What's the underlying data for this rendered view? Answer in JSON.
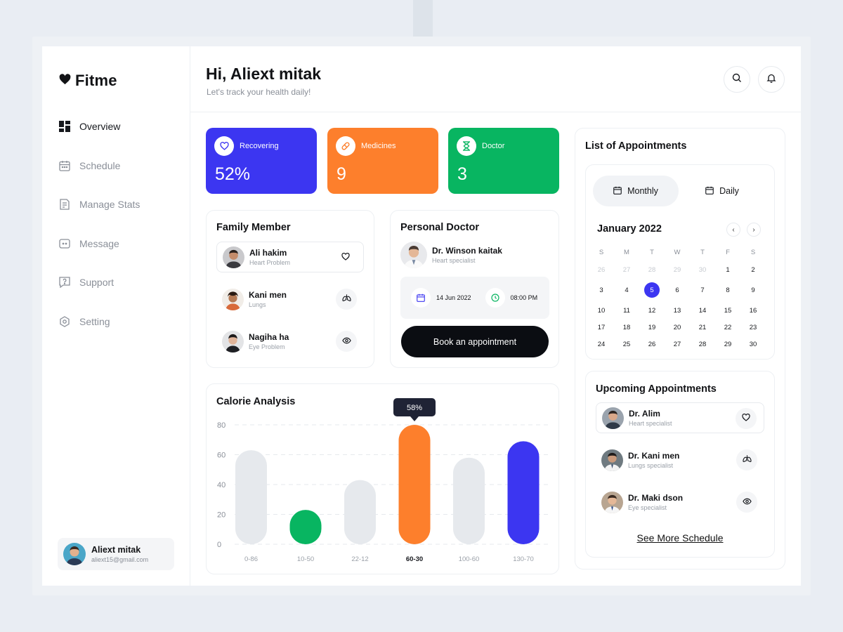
{
  "brand": {
    "name": "Fitme"
  },
  "sidebar": {
    "items": [
      {
        "label": "Overview",
        "active": true,
        "icon": "grid-icon"
      },
      {
        "label": "Schedule",
        "active": false,
        "icon": "calendar-icon"
      },
      {
        "label": "Manage Stats",
        "active": false,
        "icon": "report-icon"
      },
      {
        "label": "Message",
        "active": false,
        "icon": "message-icon"
      },
      {
        "label": "Support",
        "active": false,
        "icon": "support-icon"
      },
      {
        "label": "Setting",
        "active": false,
        "icon": "hexagon-settings-icon"
      }
    ],
    "user": {
      "name": "Aliext mitak",
      "email": "aliext15@gmail.com"
    }
  },
  "header": {
    "title": "Hi, Aliext mitak",
    "subtitle": "Let's track your health daily!"
  },
  "stats": [
    {
      "label": "Recovering",
      "value": "52%",
      "color": "#3c36f1",
      "icon": "heart-icon"
    },
    {
      "label": "Medicines",
      "value": "9",
      "color": "#fd7f2c",
      "icon": "pill-icon"
    },
    {
      "label": "Doctor",
      "value": "3",
      "color": "#08b561",
      "icon": "hourglass-icon"
    }
  ],
  "family": {
    "title": "Family Member",
    "members": [
      {
        "name": "Ali hakim",
        "condition": "Heart Problem",
        "icon": "heart-icon"
      },
      {
        "name": "Kani men",
        "condition": "Lungs",
        "icon": "lungs-icon"
      },
      {
        "name": "Nagiha ha",
        "condition": "Eye Problem",
        "icon": "eye-icon"
      }
    ]
  },
  "doctor": {
    "title": "Personal Doctor",
    "name": "Dr. Winson kaitak",
    "specialty": "Heart specialist",
    "date": "14 Jun 2022",
    "time": "08:00 PM",
    "book_label": "Book an appointment"
  },
  "calorie": {
    "title": "Calorie Analysis",
    "tooltip": "58%"
  },
  "chart_data": {
    "type": "bar",
    "title": "Calorie Analysis",
    "categories": [
      "0-86",
      "10-50",
      "22-12",
      "60-30",
      "100-60",
      "130-70"
    ],
    "values": [
      63,
      23,
      43,
      80,
      58,
      69
    ],
    "colors": [
      "#e6e9ed",
      "#08b561",
      "#e6e9ed",
      "#fd7f2c",
      "#e6e9ed",
      "#3c36f1"
    ],
    "highlight_index": 3,
    "yticks": [
      0,
      20,
      40,
      60,
      80
    ],
    "ylim": [
      0,
      80
    ],
    "grid": true
  },
  "appointments": {
    "title": "List of Appointments",
    "tabs": [
      {
        "label": "Monthly",
        "active": true
      },
      {
        "label": "Daily",
        "active": false
      }
    ],
    "calendar": {
      "month": "January 2022",
      "dow": [
        "S",
        "M",
        "T",
        "W",
        "T",
        "F",
        "S"
      ],
      "weeks": [
        [
          "26",
          "27",
          "28",
          "29",
          "30",
          "1",
          "2"
        ],
        [
          "3",
          "4",
          "5",
          "6",
          "7",
          "8",
          "9"
        ],
        [
          "10",
          "11",
          "12",
          "13",
          "14",
          "15",
          "16"
        ],
        [
          "17",
          "18",
          "19",
          "20",
          "21",
          "22",
          "23"
        ],
        [
          "24",
          "25",
          "26",
          "27",
          "28",
          "29",
          "30"
        ]
      ],
      "selected": "5"
    }
  },
  "upcoming": {
    "title": "Upcoming Appointments",
    "items": [
      {
        "name": "Dr. Alim",
        "specialty": "Heart specialist",
        "icon": "heart-icon"
      },
      {
        "name": "Dr. Kani men",
        "specialty": "Lungs specialist",
        "icon": "lungs-icon"
      },
      {
        "name": "Dr. Maki dson",
        "specialty": "Eye specialist",
        "icon": "eye-icon"
      }
    ],
    "see_more": "See More Schedule"
  }
}
